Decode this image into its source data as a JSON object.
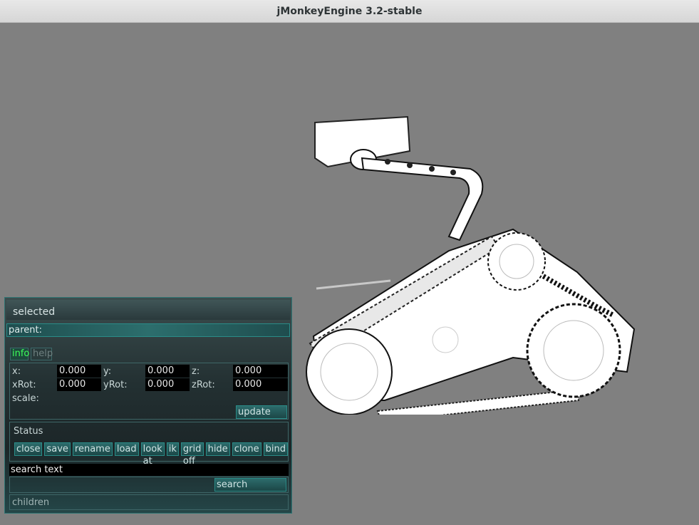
{
  "window": {
    "title": "jMonkeyEngine 3.2-stable"
  },
  "panel": {
    "header": "selected",
    "parent_label": "parent:",
    "tabs": {
      "info": "info",
      "help": "help"
    },
    "transform": {
      "x_label": "x:",
      "x_value": "0.000",
      "y_label": "y:",
      "y_value": "0.000",
      "z_label": "z:",
      "z_value": "0.000",
      "xrot_label": "xRot:",
      "xrot_value": "0.000",
      "yrot_label": "yRot:",
      "yrot_value": "0.000",
      "zrot_label": "zRot:",
      "zrot_value": "0.000",
      "scale_label": "scale:",
      "update_label": "update"
    },
    "status_label": "Status",
    "actions": [
      "close",
      "save",
      "rename",
      "load",
      "look at",
      "ik",
      "grid off",
      "hide",
      "clone",
      "bind"
    ],
    "search_text": "search text",
    "search_button": "search",
    "children_label": "children"
  },
  "colors": {
    "viewport": "#808080",
    "accent": "#2a8c88",
    "active_tab": "#3cff5a"
  }
}
